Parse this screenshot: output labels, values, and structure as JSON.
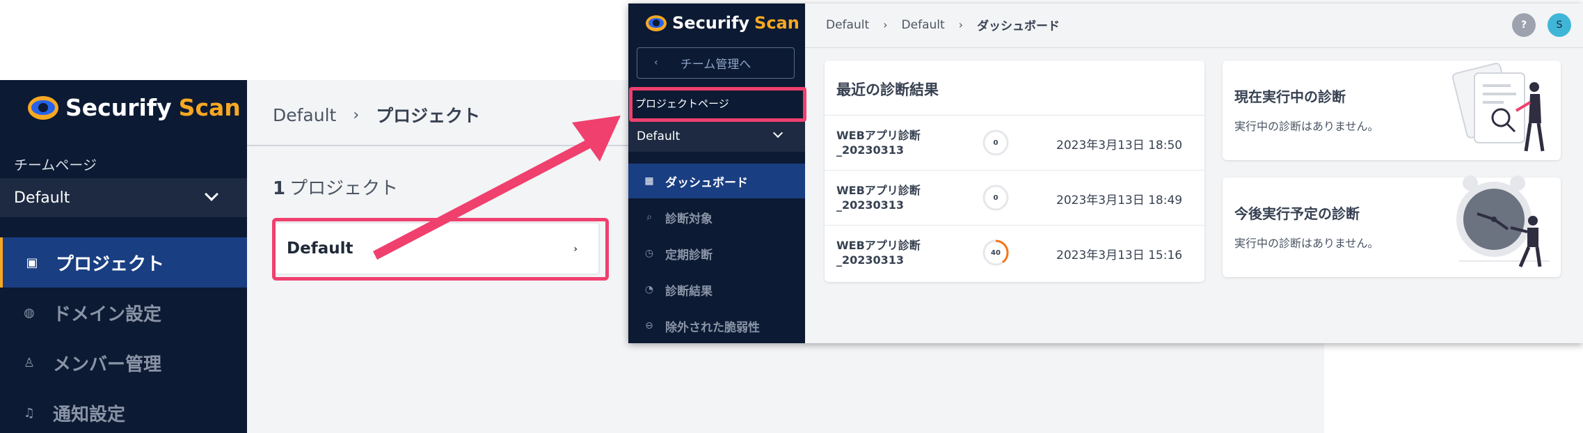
{
  "bg": {
    "logo_main": "Securify",
    "logo_accent": "Scan",
    "team_label": "チームページ",
    "team_select": "Default",
    "nav": {
      "project": "プロジェクト",
      "domain": "ドメイン設定",
      "member": "メンバー管理",
      "notify": "通知設定"
    },
    "breadcrumb": {
      "root": "Default",
      "sep": "›",
      "current": "プロジェクト"
    },
    "count_num": "1",
    "count_label": "プロジェクト",
    "project_card": "Default",
    "project_card_arrow": "›"
  },
  "fg": {
    "logo_main": "Securify",
    "logo_accent": "Scan",
    "back_button": "チーム管理へ",
    "back_icon": "‹",
    "page_label": "プロジェクトページ",
    "team_select": "Default",
    "nav": {
      "dashboard": "ダッシュボード",
      "target": "診断対象",
      "periodic": "定期診断",
      "results": "診断結果",
      "excluded": "除外された脆弱性"
    },
    "breadcrumb": {
      "a": "Default",
      "b": "Default",
      "current": "ダッシュボード",
      "sep": "›"
    },
    "help": "?",
    "avatar": "S",
    "recent": {
      "title": "最近の診断結果",
      "rows": [
        {
          "name1": "WEBアプリ診断",
          "name2": "_20230313",
          "score": "0",
          "progress": 0,
          "date": "2023年3月13日 18:50"
        },
        {
          "name1": "WEBアプリ診断",
          "name2": "_20230313",
          "score": "0",
          "progress": 0,
          "date": "2023年3月13日 18:49"
        },
        {
          "name1": "WEBアプリ診断",
          "name2": "_20230313",
          "score": "40",
          "progress": 0.4,
          "date": "2023年3月13日 15:16"
        }
      ]
    },
    "running": {
      "title": "現在実行中の診断",
      "text": "実行中の診断はありません。"
    },
    "scheduled": {
      "title": "今後実行予定の診断",
      "text": "実行中の診断はありません。"
    }
  },
  "colors": {
    "sidebar": "#0c1a33",
    "active_nav": "#1a3e82",
    "accent": "#f7a823",
    "highlight": "#f0406e",
    "progress": "#f97316"
  }
}
